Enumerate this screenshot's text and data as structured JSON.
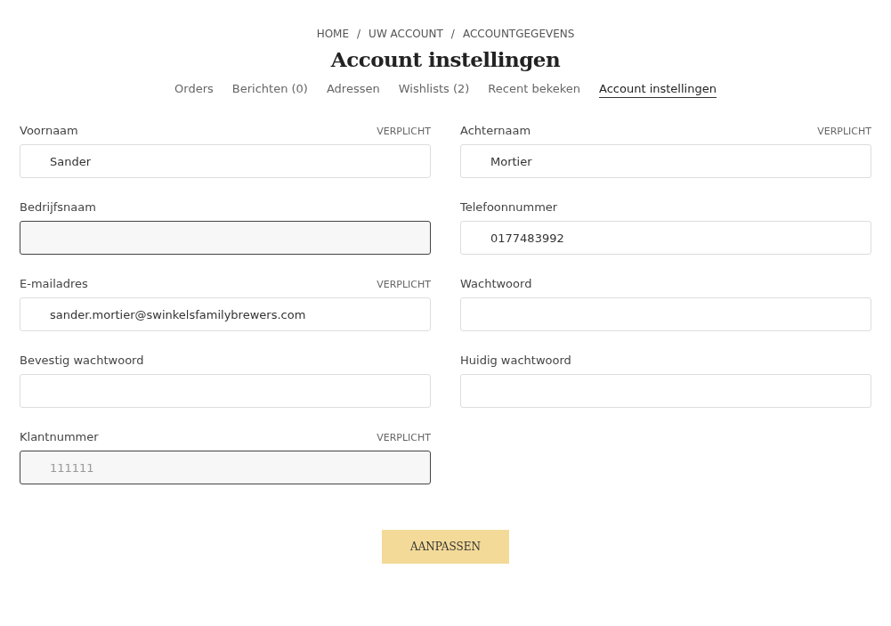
{
  "breadcrumb": [
    "HOME",
    "UW ACCOUNT",
    "ACCOUNTGEGEVENS"
  ],
  "breadcrumb_separator": "/",
  "title": "Account instellingen",
  "tabs": [
    {
      "label": "Orders",
      "selected": false
    },
    {
      "label": "Berichten (0)",
      "selected": false
    },
    {
      "label": "Adressen",
      "selected": false
    },
    {
      "label": "Wishlists (2)",
      "selected": false
    },
    {
      "label": "Recent bekeken",
      "selected": false
    },
    {
      "label": "Account instellingen",
      "selected": true
    }
  ],
  "fields": [
    {
      "label": "Voornaam",
      "required_note": "VERPLICHT",
      "value": "Sander",
      "disabled": false
    },
    {
      "label": "Achternaam",
      "required_note": "VERPLICHT",
      "value": "Mortier",
      "disabled": false
    },
    {
      "label": "Bedrijfsnaam",
      "disabled": true
    },
    {
      "label": "Telefoonnummer",
      "value": "0177483992",
      "disabled": false
    },
    {
      "label": "E-mailadres",
      "required_note": "VERPLICHT",
      "value": "sander.mortier@swinkelsfamilybrewers.com",
      "disabled": false
    },
    {
      "label": "Wachtwoord",
      "disabled": false
    },
    {
      "label": "Bevestig wachtwoord",
      "disabled": false
    },
    {
      "label": "Huidig wachtwoord",
      "disabled": false
    },
    {
      "label": "Klantnummer",
      "required_note": "VERPLICHT",
      "value": "111111",
      "disabled": true
    }
  ],
  "submit_button": "AANPASSEN"
}
